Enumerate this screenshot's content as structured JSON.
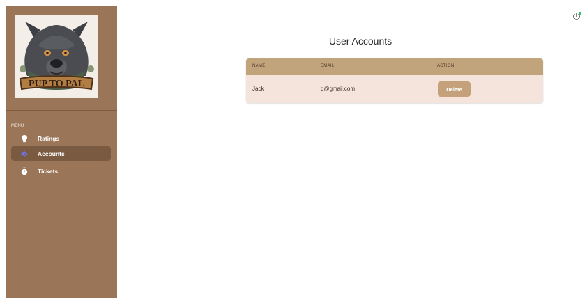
{
  "sidebar": {
    "logo_text": "PUP TO PAL",
    "menu_title": "MENU",
    "items": [
      {
        "label": "Ratings",
        "icon": "lightbulb-icon",
        "active": false
      },
      {
        "label": "Accounts",
        "icon": "gear-icon",
        "active": true
      },
      {
        "label": "Tickets",
        "icon": "stopwatch-icon",
        "active": false
      }
    ]
  },
  "header": {
    "power_icon": "power-icon",
    "status_color": "#2fbf71"
  },
  "main": {
    "title": "User Accounts",
    "table": {
      "headers": [
        "NAME",
        "EMAIL",
        "ACTION"
      ],
      "rows": [
        {
          "name": "Jack",
          "email": "d@gmail.com",
          "action": "Delete"
        }
      ]
    }
  },
  "colors": {
    "sidebar": "#9a7557",
    "accent": "#c2a47c",
    "row_bg": "#f5e4dc"
  }
}
